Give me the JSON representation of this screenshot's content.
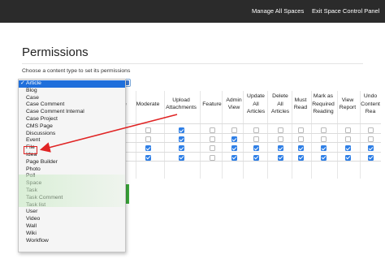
{
  "topbar": {
    "manage_label": "Manage All Spaces",
    "exit_label": "Exit Space Control Panel"
  },
  "page": {
    "title": "Permissions",
    "choose_label": "Choose a content type to set its permissions"
  },
  "content_type_select": {
    "selected": "Article",
    "options": [
      "Article",
      "Blog",
      "Case",
      "Case Comment",
      "Case Comment Internal",
      "Case Project",
      "CMS Page",
      "Discussions",
      "Event",
      "File",
      "Idea",
      "Page Builder",
      "Photo",
      "Poll",
      "Space",
      "Task",
      "Task Comment",
      "Task list",
      "User",
      "Video",
      "Wall",
      "Wiki",
      "Workflow"
    ]
  },
  "table": {
    "headers": [
      [
        "te"
      ],
      [
        "Moderate"
      ],
      [
        "Upload",
        "Attachments"
      ],
      [
        "Feature"
      ],
      [
        "Admin",
        "View"
      ],
      [
        "Update",
        "All",
        "Articles"
      ],
      [
        "Delete",
        "All",
        "Articles"
      ],
      [
        "Must",
        "Read"
      ],
      [
        "Mark as",
        "Required",
        "Reading"
      ],
      [
        "View",
        "Report"
      ],
      [
        "Undo",
        "Content",
        "Rea"
      ]
    ],
    "rows": [
      [
        false,
        true,
        false,
        false,
        false,
        false,
        false,
        false,
        false,
        false
      ],
      [
        false,
        true,
        false,
        true,
        false,
        false,
        false,
        false,
        false,
        false
      ],
      [
        true,
        true,
        false,
        true,
        true,
        true,
        true,
        true,
        true,
        true
      ],
      [
        true,
        true,
        false,
        true,
        true,
        true,
        true,
        true,
        true,
        true
      ]
    ]
  },
  "colors": {
    "topbar": "#2b2b2b",
    "selected_option": "#1f6fdb",
    "checkbox_on": "#2f7fe6",
    "annotation": "#e02424"
  }
}
